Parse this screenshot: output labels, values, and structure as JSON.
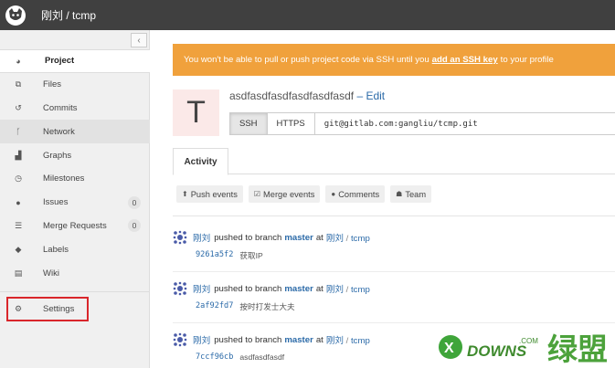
{
  "header": {
    "title": "刚刘 / tcmp"
  },
  "sidebar": {
    "collapse_icon": "chevron-left-icon",
    "items": [
      {
        "label": "Project",
        "icon": "dashboard-icon"
      },
      {
        "label": "Files",
        "icon": "files-icon"
      },
      {
        "label": "Commits",
        "icon": "history-icon"
      },
      {
        "label": "Network",
        "icon": "code-fork-icon"
      },
      {
        "label": "Graphs",
        "icon": "area-chart-icon"
      },
      {
        "label": "Milestones",
        "icon": "clock-icon"
      },
      {
        "label": "Issues",
        "icon": "exclamation-circle-icon",
        "count": "0"
      },
      {
        "label": "Merge Requests",
        "icon": "tasks-icon",
        "count": "0"
      },
      {
        "label": "Labels",
        "icon": "tags-icon"
      },
      {
        "label": "Wiki",
        "icon": "book-icon"
      }
    ],
    "settings": {
      "label": "Settings",
      "icon": "cogs-icon"
    }
  },
  "alert": {
    "before": "You won't be able to pull or push project code via SSH until you",
    "link": "add an SSH key",
    "after": "to your profile"
  },
  "project": {
    "avatar_letter": "T",
    "name": "asdfasdfasdfasdfasdfasdf",
    "edit": "– Edit"
  },
  "clone": {
    "ssh": "SSH",
    "https": "HTTPS",
    "url": "git@gitlab.com:gangliu/tcmp.git"
  },
  "tabs": {
    "activity": "Activity"
  },
  "filters": [
    {
      "label": "Push events",
      "icon": "upload-icon"
    },
    {
      "label": "Merge events",
      "icon": "check-square-icon"
    },
    {
      "label": "Comments",
      "icon": "comments-icon"
    },
    {
      "label": "Team",
      "icon": "users-icon"
    }
  ],
  "events": [
    {
      "author": "刚刘",
      "action": "pushed to branch",
      "branch": "master",
      "at": "at",
      "namespace": "刚刘",
      "project": "tcmp",
      "sha": "9261a5f2",
      "message": "获取IP"
    },
    {
      "author": "刚刘",
      "action": "pushed to branch",
      "branch": "master",
      "at": "at",
      "namespace": "刚刘",
      "project": "tcmp",
      "sha": "2af92fd7",
      "message": "按时打发士大夫"
    },
    {
      "author": "刚刘",
      "action": "pushed to branch",
      "branch": "master",
      "at": "at",
      "namespace": "刚刘",
      "project": "tcmp",
      "sha": "7ccf96cb",
      "message": "asdfasdfasdf"
    }
  ],
  "watermark": {
    "text": "DOWNS",
    "suffix": ".COM",
    "cn": "绿盟"
  },
  "colors": {
    "header": "#404040",
    "alert": "#f0a13c",
    "link": "#2b6aa8",
    "settings_highlight": "#d9262b"
  }
}
